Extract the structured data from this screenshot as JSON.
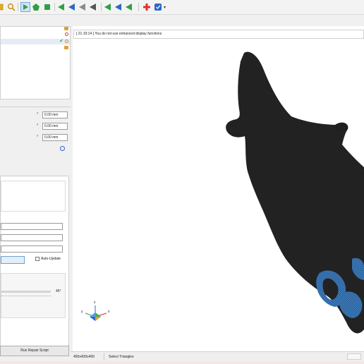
{
  "toolbar": {
    "icons": [
      "cube-icon",
      "magnifier-icon",
      "select-arrow-icon",
      "pentagon-icon",
      "square-icon",
      "triangle-select-icon",
      "triangle-select-icon",
      "triangle-select-icon",
      "triangle-select-icon",
      "triangle-select-icon",
      "triangle-select-icon",
      "triangle-select-icon",
      "add-plus-icon",
      "settings-icon"
    ],
    "colors": {
      "green": "#2ea043",
      "blue": "#2f66c8",
      "red": "#e03030",
      "yellow": "#e0b020"
    }
  },
  "left_panel": {
    "offsets": [
      {
        "value": "0.00 mm"
      },
      {
        "value": "0.00 mm"
      },
      {
        "value": "0.00 mm"
      }
    ],
    "auto_update_label": "Auto-Update",
    "angle_label": "45°",
    "run_repair_label": "Run Repair Script"
  },
  "viewport": {
    "message": "[ 21:19:14 ] You do not use enhanced display functions",
    "axes": {
      "x": "x",
      "y": "y",
      "z": "z"
    },
    "mesh_colors": {
      "body": "#1f1f1f",
      "selected": "#3a78b8"
    }
  },
  "status_bar": {
    "dimensions": "450x420x400",
    "mode": "Select Triangles"
  }
}
